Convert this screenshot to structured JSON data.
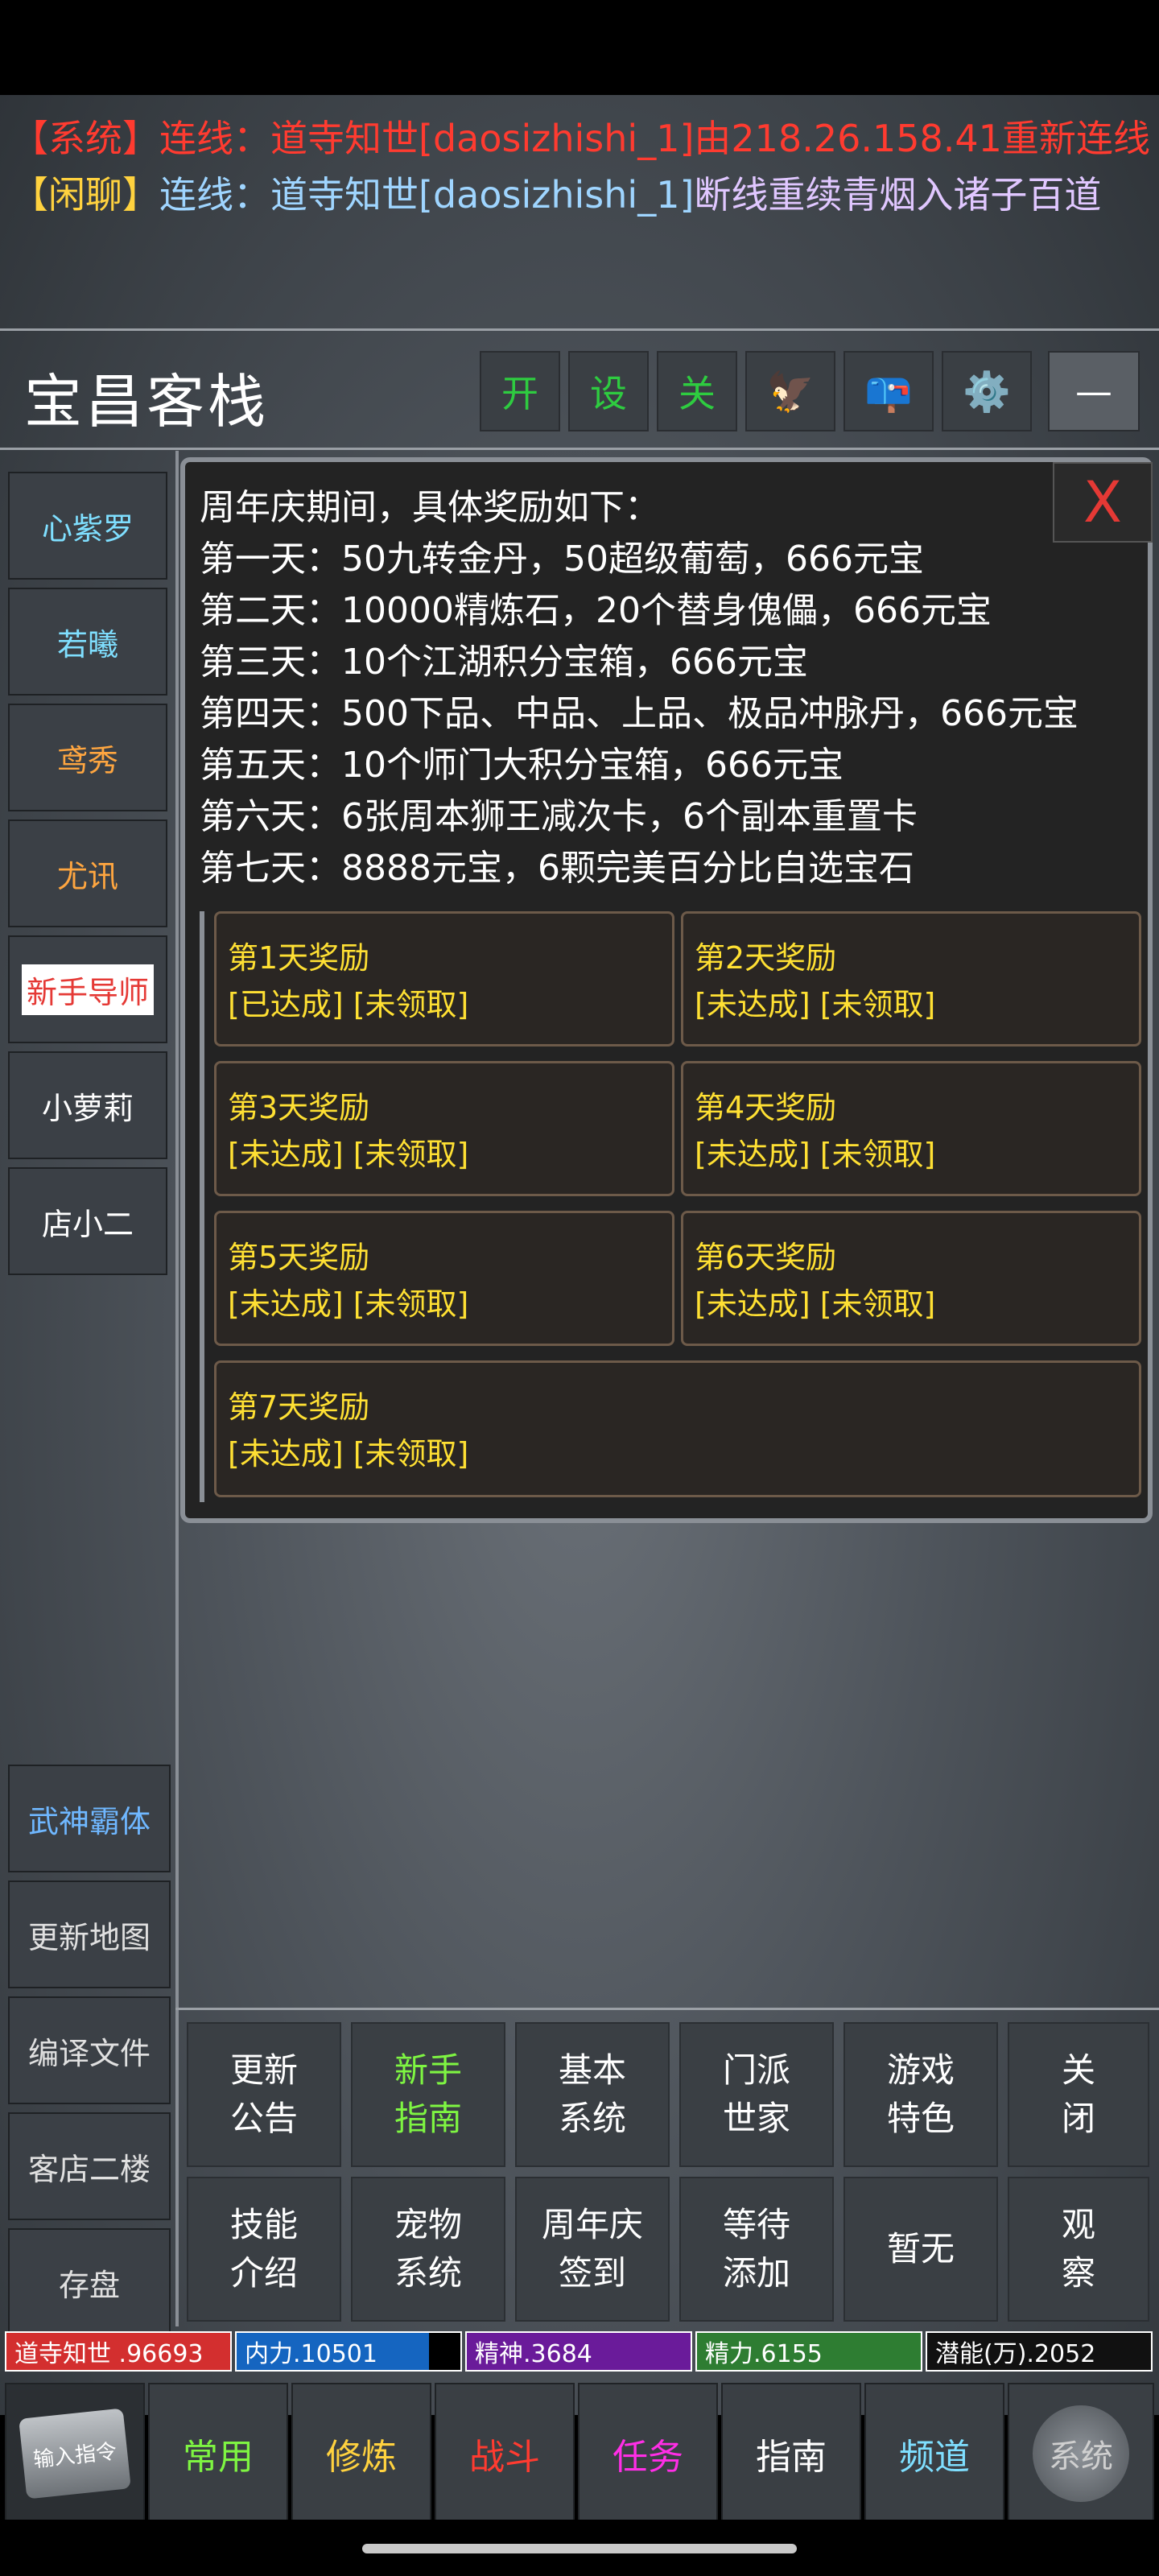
{
  "messages": [
    {
      "text": "【系统】连线：道寺知世[daosizhishi_1]由218.26.158.41重新连线"
    },
    {
      "tag": "【闲聊】",
      "prefix": "连线：道寺知世[daosizhishi_1]",
      "text": "断线重续青烟入诸子百道"
    }
  ],
  "room": {
    "title": "宝昌客栈",
    "toolbar": [
      {
        "label": "开",
        "color": "#2ecc40"
      },
      {
        "label": "设",
        "color": "#2ecc40"
      },
      {
        "label": "关",
        "color": "#2ecc40"
      },
      {
        "label": "🦅",
        "icon": "eagle-icon"
      },
      {
        "label": "📪",
        "icon": "mailbox-icon"
      },
      {
        "label": "⚙️",
        "icon": "gear-icon"
      },
      {
        "label": "—",
        "icon": "minimize-icon"
      }
    ]
  },
  "npcs": [
    {
      "label": "心紫罗",
      "color": "#7fdfff"
    },
    {
      "label": "若曦",
      "color": "#7fdfff"
    },
    {
      "label": "鸢秀",
      "color": "#ffa640"
    },
    {
      "label": "尤讯",
      "color": "#ffa640"
    },
    {
      "label": "新手导师",
      "color": "#e53935"
    },
    {
      "label": "小萝莉",
      "color": "#ffffff"
    },
    {
      "label": "店小二",
      "color": "#ffffff"
    }
  ],
  "side_buttons": [
    {
      "label": "武神霸体",
      "color": "#6fb7ff"
    },
    {
      "label": "更新地图"
    },
    {
      "label": "编译文件"
    },
    {
      "label": "客店二楼"
    },
    {
      "label": "存盘"
    }
  ],
  "panel": {
    "close_label": "X",
    "lines": [
      "周年庆期间，具体奖励如下：",
      "第一天：50九转金丹，50超级葡萄，666元宝",
      "第二天：10000精炼石，20个替身傀儡，666元宝",
      "第三天：10个江湖积分宝箱，666元宝",
      "第四天：500下品、中品、上品、极品冲脉丹，666元宝",
      "第五天：10个师门大积分宝箱，666元宝",
      "第六天：6张周本狮王减次卡，6个副本重置卡",
      "第七天：8888元宝，6颗完美百分比自选宝石"
    ],
    "rewards": [
      {
        "title": "第1天奖励",
        "status": "[已达成] [未领取]"
      },
      {
        "title": "第2天奖励",
        "status": "[未达成] [未领取]"
      },
      {
        "title": "第3天奖励",
        "status": "[未达成] [未领取]"
      },
      {
        "title": "第4天奖励",
        "status": "[未达成] [未领取]"
      },
      {
        "title": "第5天奖励",
        "status": "[未达成] [未领取]"
      },
      {
        "title": "第6天奖励",
        "status": "[未达成] [未领取]"
      },
      {
        "title": "第7天奖励",
        "status": "[未达成] [未领取]"
      }
    ]
  },
  "menu": [
    {
      "label": "更新\n公告",
      "color": "#ffffff"
    },
    {
      "label": "新手\n指南",
      "color": "#7ef542"
    },
    {
      "label": "基本\n系统",
      "color": "#ffffff"
    },
    {
      "label": "门派\n世家",
      "color": "#ffffff"
    },
    {
      "label": "游戏\n特色",
      "color": "#ffffff"
    },
    {
      "label": "关\n闭",
      "color": "#ffffff"
    },
    {
      "label": "技能\n介绍",
      "color": "#ffffff"
    },
    {
      "label": "宠物\n系统",
      "color": "#ffffff"
    },
    {
      "label": "周年庆\n签到",
      "color": "#ffffff"
    },
    {
      "label": "等待\n添加",
      "color": "#ffffff"
    },
    {
      "label": "暂无",
      "color": "#ffffff"
    },
    {
      "label": "观\n察",
      "color": "#ffffff"
    }
  ],
  "stats": [
    {
      "label": "道寺知世 .96693",
      "bg": "#d32f2f"
    },
    {
      "label": "内力.10501",
      "bg": "#1565c0"
    },
    {
      "label": "精神.3684",
      "bg": "#6a1b9a"
    },
    {
      "label": "精力.6155",
      "bg": "#2e7d32"
    },
    {
      "label": "潜能(万).2052",
      "bg": "#111111"
    }
  ],
  "bottom_nav": [
    {
      "label": "输入指令",
      "color": "#ffffff"
    },
    {
      "label": "常用",
      "color": "#7ef542"
    },
    {
      "label": "修炼",
      "color": "#ffd23f"
    },
    {
      "label": "战斗",
      "color": "#ff3b30"
    },
    {
      "label": "任务",
      "color": "#ff2ee6"
    },
    {
      "label": "指南",
      "color": "#ffffff"
    },
    {
      "label": "频道",
      "color": "#7fdfff"
    },
    {
      "label": "系统",
      "color": "#cfcfcf"
    }
  ]
}
